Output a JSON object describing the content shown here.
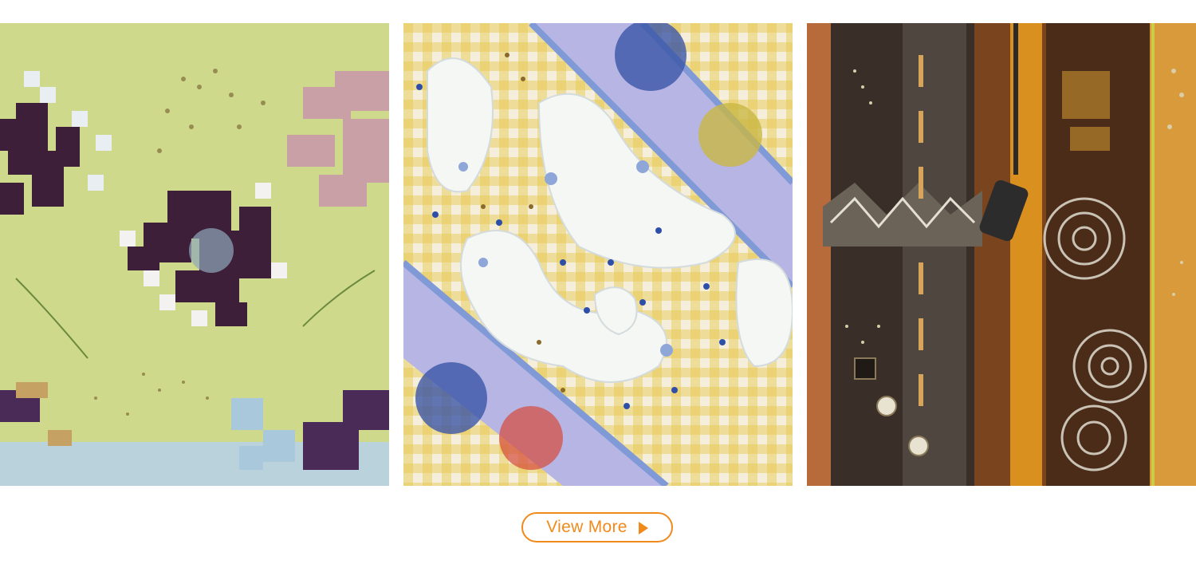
{
  "gallery": {
    "images": [
      {
        "name": "green-embellished-textile",
        "colors": {
          "base": "#cfd98b",
          "accent": "#3d1f3a",
          "pink": "#c9a0a6",
          "blue": "#a9c8dc"
        }
      },
      {
        "name": "white-quilted-gingham-textile",
        "colors": {
          "base": "#f1ead2",
          "check": "#e8c84a",
          "stripe": "#b7b5e3",
          "puff": "#f3f6f2"
        }
      },
      {
        "name": "earth-tone-beaded-textile",
        "colors": {
          "base": "#b76a3a",
          "dark": "#3a2f28",
          "gold": "#d9901f",
          "brown": "#6b3c1c"
        }
      }
    ]
  },
  "cta": {
    "label": "View More",
    "color": "#f08a1c",
    "icon": "play-triangle-icon"
  }
}
